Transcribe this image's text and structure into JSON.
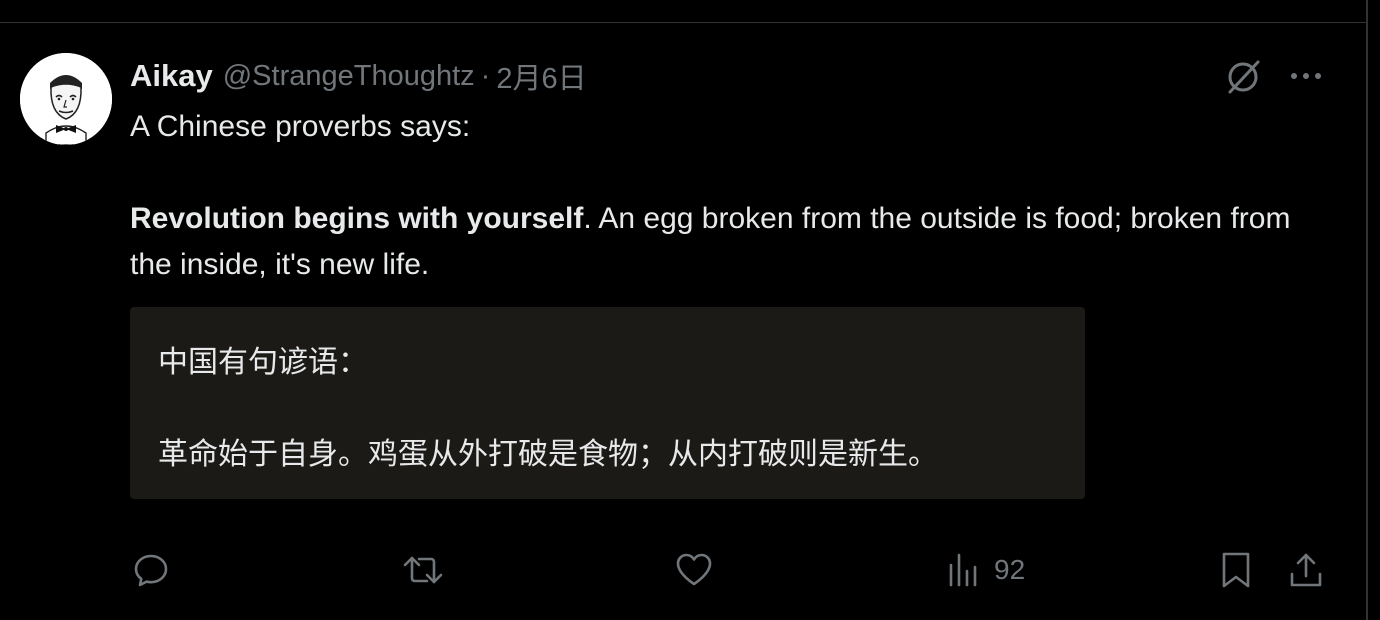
{
  "tweet": {
    "author": {
      "display_name": "Aikay",
      "handle": "@StrangeThoughtz",
      "avatar_icon": "cartoon-face-avatar"
    },
    "separator": "·",
    "date": "2月6日",
    "text": {
      "line1": "A Chinese proverbs says:",
      "bold": "Revolution begins with yourself",
      "rest": ". An egg broken from the outside is food; broken from the inside, it's new life."
    },
    "translation": {
      "line1": "中国有句谚语：",
      "line2": "革命始于自身。鸡蛋从外打破是食物；从内打破则是新生。"
    },
    "actions": {
      "reply_icon": "reply-icon",
      "retweet_icon": "retweet-icon",
      "like_icon": "heart-icon",
      "views_icon": "views-icon",
      "views_count": "92",
      "bookmark_icon": "bookmark-icon",
      "share_icon": "share-icon"
    },
    "header_icons": {
      "grok": "grok-icon",
      "more": "more-icon"
    }
  },
  "colors": {
    "background": "#000000",
    "text_primary": "#e7e9ea",
    "text_secondary": "#71767b",
    "border": "#2f3336",
    "translation_bg": "#1c1a17"
  }
}
